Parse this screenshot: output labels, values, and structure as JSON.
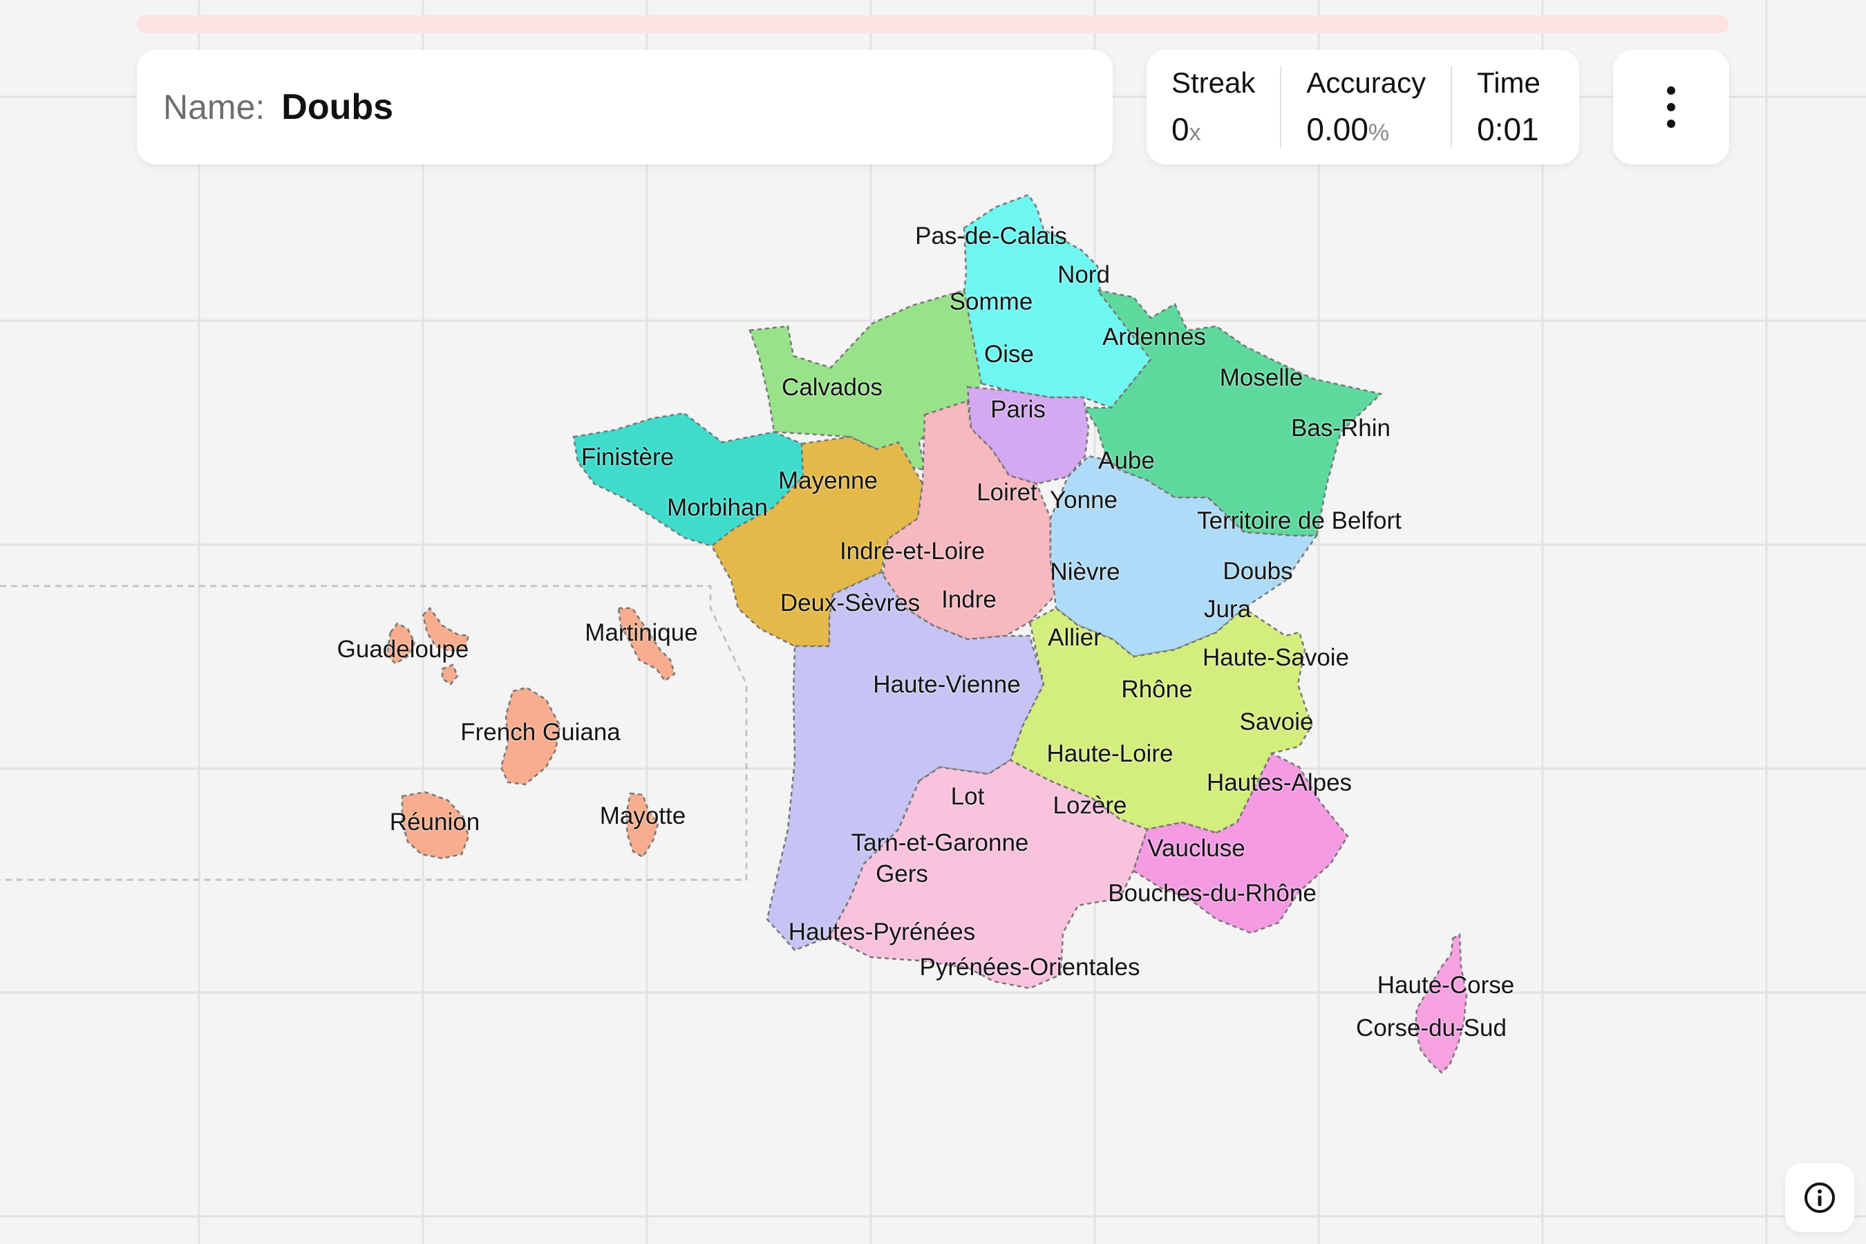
{
  "game": {
    "progress_percent": 0,
    "name_label": "Name:",
    "current_name": "Doubs",
    "stats": {
      "streak_label": "Streak",
      "streak_value": "0",
      "streak_unit": "x",
      "accuracy_label": "Accuracy",
      "accuracy_value": "0.00",
      "accuracy_unit": "%",
      "time_label": "Time",
      "time_value": "0:01"
    }
  },
  "colors": {
    "progress_track": "#fde2e2",
    "hauts_de_france": "#6ff8f2",
    "normandie": "#98e28a",
    "bretagne": "#3fdccb",
    "pays_de_la_loire": "#e4b94a",
    "ile_de_france": "#d5a8f2",
    "centre_val_de_loire": "#f8b8c0",
    "grand_est": "#5ed99d",
    "bourgogne_franche_comte": "#aedbf8",
    "nouvelle_aquitaine": "#c6c4f4",
    "auvergne_rhone_alpes": "#d4ee7e",
    "occitanie": "#f9c2dd",
    "paca": "#f59be3",
    "corse": "#f6a2e0",
    "overseas": "#f8ad8e"
  },
  "map_labels": {
    "pas_de_calais": "Pas-de-Calais",
    "nord": "Nord",
    "somme": "Somme",
    "ardennes": "Ardennes",
    "oise": "Oise",
    "moselle": "Moselle",
    "calvados": "Calvados",
    "paris": "Paris",
    "bas_rhin": "Bas-Rhin",
    "finistere": "Finistère",
    "aube": "Aube",
    "mayenne": "Mayenne",
    "loiret": "Loiret",
    "yonne": "Yonne",
    "morbihan": "Morbihan",
    "territoire_de_belfort": "Territoire de Belfort",
    "indre_et_loire": "Indre-et-Loire",
    "nievre": "Nièvre",
    "doubs": "Doubs",
    "deux_sevres": "Deux-Sèvres",
    "indre": "Indre",
    "jura": "Jura",
    "allier": "Allier",
    "haute_savoie": "Haute-Savoie",
    "guadeloupe": "Guadeloupe",
    "martinique": "Martinique",
    "haute_vienne": "Haute-Vienne",
    "rhone": "Rhône",
    "french_guiana": "French Guiana",
    "savoie": "Savoie",
    "haute_loire": "Haute-Loire",
    "hautes_alpes": "Hautes-Alpes",
    "lot": "Lot",
    "lozere": "Lozère",
    "reunion": "Réunion",
    "mayotte": "Mayotte",
    "tarn_et_garonne": "Tarn-et-Garonne",
    "vaucluse": "Vaucluse",
    "gers": "Gers",
    "bouches_du_rhone": "Bouches-du-Rhône",
    "hautes_pyrenees": "Hautes-Pyrénées",
    "pyrenees_orientales": "Pyrénées-Orientales",
    "haute_corse": "Haute-Corse",
    "corse_du_sud": "Corse-du-Sud"
  },
  "icons": {
    "menu": "more-vertical-icon",
    "info": "info-icon"
  }
}
